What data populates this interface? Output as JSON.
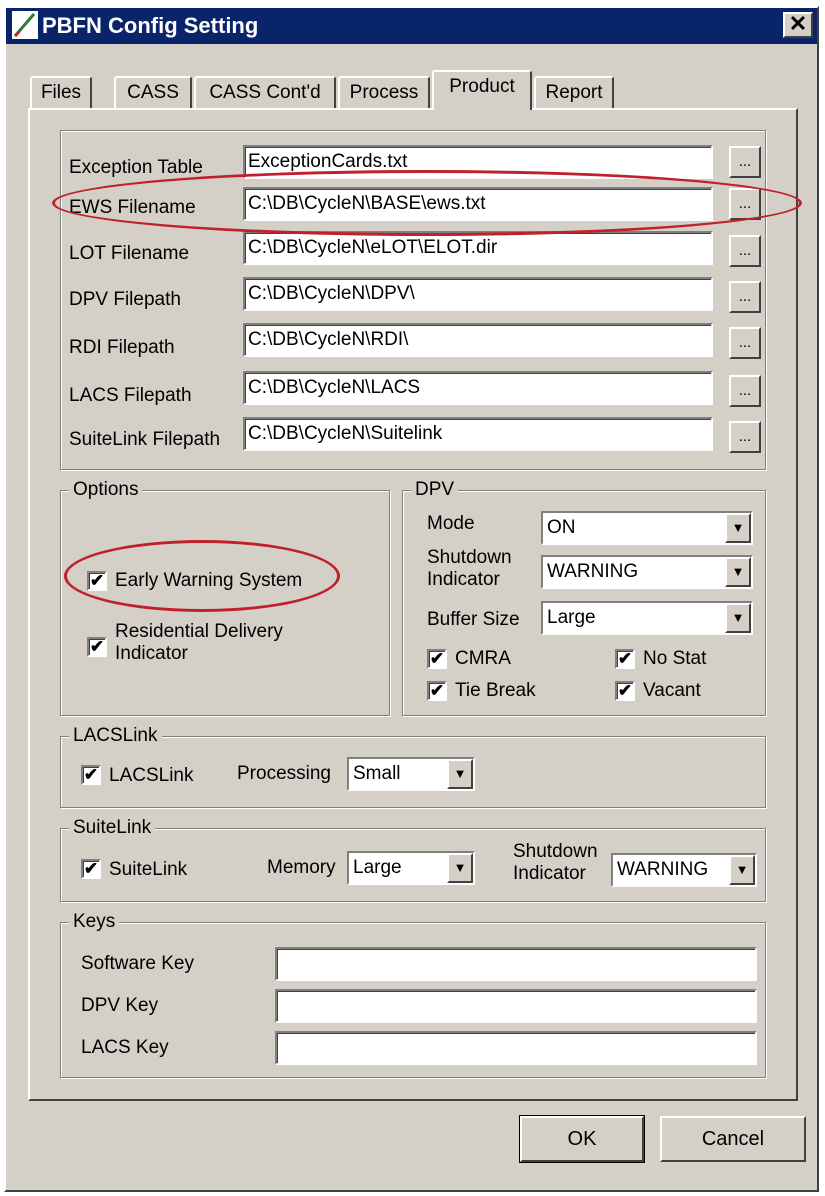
{
  "window": {
    "title": "PBFN Config Setting",
    "close_glyph": "✕"
  },
  "tabs": [
    {
      "label": "Files"
    },
    {
      "label": "CASS"
    },
    {
      "label": "CASS Cont'd"
    },
    {
      "label": "Process"
    },
    {
      "label": "Product"
    },
    {
      "label": "Report"
    }
  ],
  "files": {
    "browse_label": "...",
    "rows": [
      {
        "label": "Exception Table",
        "value": "ExceptionCards.txt"
      },
      {
        "label": "EWS Filename",
        "value": "C:\\DB\\CycleN\\BASE\\ews.txt"
      },
      {
        "label": "LOT Filename",
        "value": "C:\\DB\\CycleN\\eLOT\\ELOT.dir"
      },
      {
        "label": "DPV Filepath",
        "value": "C:\\DB\\CycleN\\DPV\\"
      },
      {
        "label": "RDI Filepath",
        "value": "C:\\DB\\CycleN\\RDI\\"
      },
      {
        "label": "LACS Filepath",
        "value": "C:\\DB\\CycleN\\LACS"
      },
      {
        "label": "SuiteLink Filepath",
        "value": "C:\\DB\\CycleN\\Suitelink"
      }
    ]
  },
  "options": {
    "title": "Options",
    "early_warning": {
      "label": "Early Warning System",
      "checked": true
    },
    "rdi": {
      "label_line1": "Residential Delivery",
      "label_line2": "Indicator",
      "checked": true
    }
  },
  "dpv": {
    "title": "DPV",
    "mode_label": "Mode",
    "mode_value": "ON",
    "shutdown_label_line1": "Shutdown",
    "shutdown_label_line2": "Indicator",
    "shutdown_value": "WARNING",
    "buffer_label": "Buffer Size",
    "buffer_value": "Large",
    "cmra": "CMRA",
    "nostat": "No Stat",
    "tiebreak": "Tie Break",
    "vacant": "Vacant"
  },
  "lacslink": {
    "title": "LACSLink",
    "check_label": "LACSLink",
    "processing_label": "Processing",
    "processing_value": "Small"
  },
  "suitelink": {
    "title": "SuiteLink",
    "check_label": "SuiteLink",
    "memory_label": "Memory",
    "memory_value": "Large",
    "shutdown_label_line1": "Shutdown",
    "shutdown_label_line2": "Indicator",
    "shutdown_value": "WARNING"
  },
  "keys": {
    "title": "Keys",
    "software_label": "Software Key",
    "dpv_label": "DPV Key",
    "lacs_label": "LACS Key",
    "software_value": "",
    "dpv_value": "",
    "lacs_value": ""
  },
  "buttons": {
    "ok": "OK",
    "cancel": "Cancel"
  },
  "glyphs": {
    "check": "✔",
    "dropdown": "▼"
  },
  "colors": {
    "titlebar": "#0a246a",
    "annotation": "#c0202a",
    "face": "#d4d0c8"
  }
}
